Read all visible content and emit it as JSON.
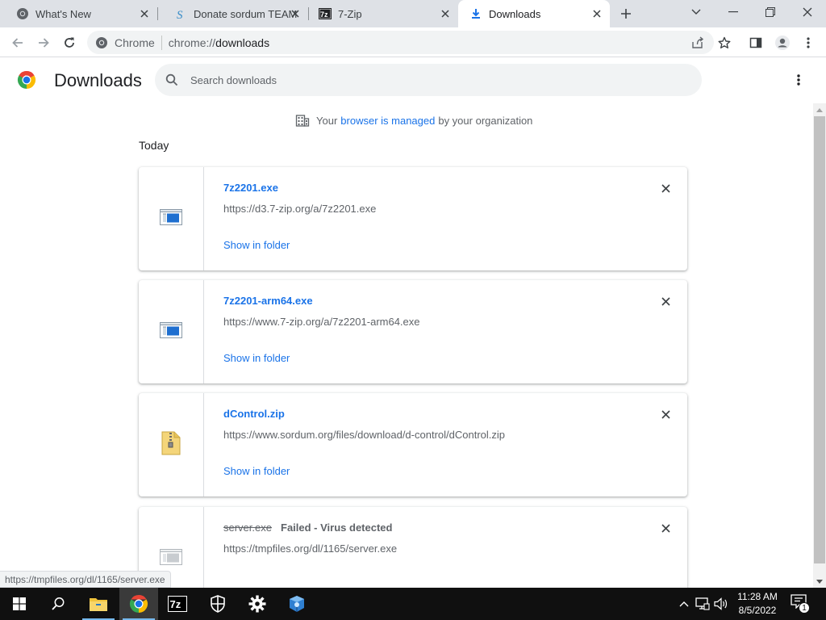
{
  "tabs": [
    {
      "title": "What's New",
      "icon": "chrome-icon",
      "active": false
    },
    {
      "title": "Donate sordum TEAM",
      "icon": "sordum-icon",
      "active": false
    },
    {
      "title": "7-Zip",
      "icon": "7zip-icon",
      "active": false
    },
    {
      "title": "Downloads",
      "icon": "download-icon",
      "active": true
    }
  ],
  "toolbar": {
    "chip_label": "Chrome",
    "url_scheme": "chrome://",
    "url_host": "downloads"
  },
  "header": {
    "title": "Downloads",
    "search_placeholder": "Search downloads"
  },
  "managed": {
    "prefix": "Your",
    "link": "browser is managed",
    "suffix": "by your organization"
  },
  "section": {
    "date": "Today"
  },
  "downloads": [
    {
      "name": "7z2201.exe",
      "url": "https://d3.7-zip.org/a/7z2201.exe",
      "action": "Show in folder",
      "status": "",
      "icon": "exe-icon"
    },
    {
      "name": "7z2201-arm64.exe",
      "url": "https://www.7-zip.org/a/7z2201-arm64.exe",
      "action": "Show in folder",
      "status": "",
      "icon": "exe-icon"
    },
    {
      "name": "dControl.zip",
      "url": "https://www.sordum.org/files/download/d-control/dControl.zip",
      "action": "Show in folder",
      "status": "",
      "icon": "zip-icon"
    },
    {
      "name": "server.exe",
      "url": "https://tmpfiles.org/dl/1165/server.exe",
      "action": "",
      "status": "Failed - Virus detected",
      "icon": "exe-icon"
    }
  ],
  "status_bubble": "https://tmpfiles.org/dl/1165/server.exe",
  "taskbar": {
    "time": "11:28 AM",
    "date": "8/5/2022",
    "notification_count": "1"
  },
  "colors": {
    "accent": "#1a73e8",
    "tabstrip": "#dee1e6",
    "taskbar": "#101010"
  }
}
